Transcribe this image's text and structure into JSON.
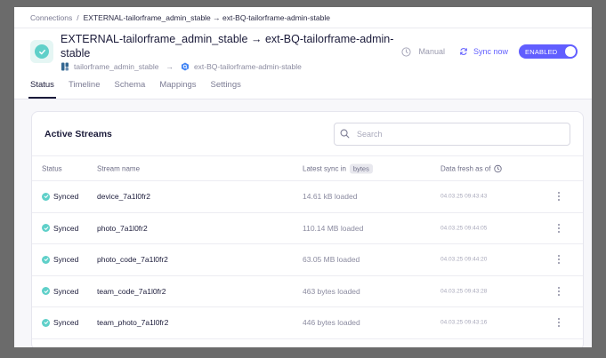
{
  "breadcrumb": {
    "root": "Connections",
    "separator": "/",
    "current": "EXTERNAL-tailorframe_admin_stable → ext-BQ-tailorframe-admin-stable"
  },
  "connection": {
    "title": "EXTERNAL-tailorframe_admin_stable → ext-BQ-tailorframe-admin-stable",
    "source": "tailorframe_admin_stable",
    "arrow": "→",
    "destination": "ext-BQ-tailorframe-admin-stable",
    "schedule": "Manual",
    "sync_label": "Sync now",
    "toggle_label": "ENABLED"
  },
  "tabs": [
    "Status",
    "Timeline",
    "Schema",
    "Mappings",
    "Settings"
  ],
  "streams": {
    "title": "Active Streams",
    "search_placeholder": "Search",
    "columns": {
      "status": "Status",
      "name": "Stream name",
      "latest_sync": "Latest sync in",
      "unit": "bytes",
      "fresh": "Data fresh as of"
    },
    "rows": [
      {
        "status": "Synced",
        "name": "device_7a1l0fr2",
        "sync": "14.61 kB loaded",
        "fresh": "04.03.25 09:43:43"
      },
      {
        "status": "Synced",
        "name": "photo_7a1l0fr2",
        "sync": "110.14 MB loaded",
        "fresh": "04.03.25 09:44:05"
      },
      {
        "status": "Synced",
        "name": "photo_code_7a1l0fr2",
        "sync": "63.05 MB loaded",
        "fresh": "04.03.25 09:44:20"
      },
      {
        "status": "Synced",
        "name": "team_code_7a1l0fr2",
        "sync": "463 bytes loaded",
        "fresh": "04.03.25 09:43:28"
      },
      {
        "status": "Synced",
        "name": "team_photo_7a1l0fr2",
        "sync": "446 bytes loaded",
        "fresh": "04.03.25 09:43:16"
      }
    ]
  },
  "colors": {
    "accent": "#615eff",
    "synced": "#5fd0c9"
  }
}
